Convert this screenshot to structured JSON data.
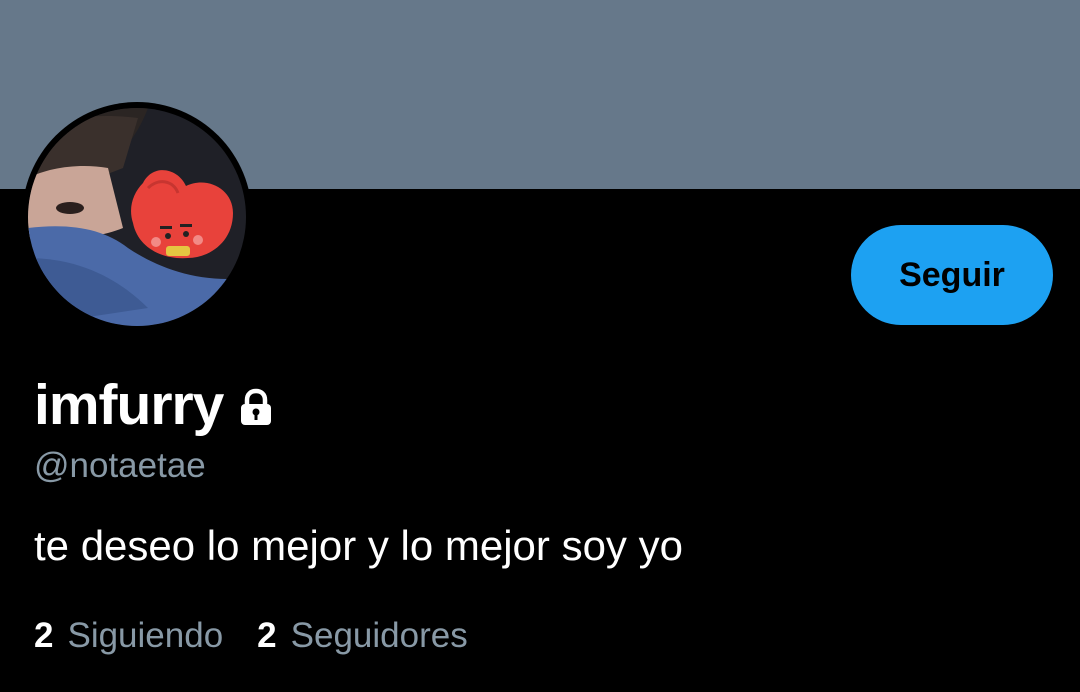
{
  "profile": {
    "banner_color": "#66788a",
    "avatar_icon": "profile-photo",
    "display_name": "imfurry",
    "protected_icon": "lock-icon",
    "username": "@notaetae",
    "bio": "te deseo lo mejor y lo mejor soy yo"
  },
  "actions": {
    "follow_label": "Seguir",
    "follow_color": "#1da1f2"
  },
  "stats": {
    "following_count": "2",
    "following_label": "Siguiendo",
    "followers_count": "2",
    "followers_label": "Seguidores"
  }
}
